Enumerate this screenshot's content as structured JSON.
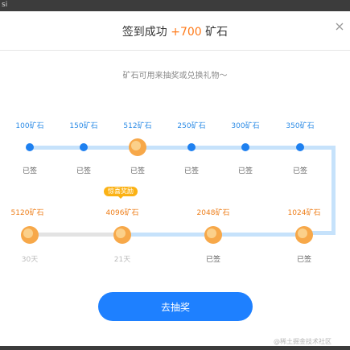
{
  "window": {
    "top_left_text": "si"
  },
  "dialog": {
    "title_prefix": "签到成功",
    "title_amount": "+700",
    "title_suffix": "矿石",
    "subtitle": "矿石可用来抽奖或兑换礼物～",
    "button_label": "去抽奖",
    "badge": "惊喜奖励",
    "watermark": "@稀土掘金技术社区"
  },
  "row1": [
    {
      "reward": "100矿石",
      "status": "已签"
    },
    {
      "reward": "150矿石",
      "status": "已签"
    },
    {
      "reward": "512矿石",
      "status": "已签"
    },
    {
      "reward": "250矿石",
      "status": "已签"
    },
    {
      "reward": "300矿石",
      "status": "已签"
    },
    {
      "reward": "350矿石",
      "status": "已签"
    }
  ],
  "row2": [
    {
      "reward": "5120矿石",
      "status": "30天"
    },
    {
      "reward": "4096矿石",
      "status": "21天"
    },
    {
      "reward": "2048矿石",
      "status": "已签"
    },
    {
      "reward": "1024矿石",
      "status": "已签"
    }
  ],
  "colors": {
    "accent_blue": "#1e80ff",
    "accent_orange": "#ff7a19",
    "track_done": "#c6e2fb",
    "track_pending": "#e3e3e3"
  }
}
